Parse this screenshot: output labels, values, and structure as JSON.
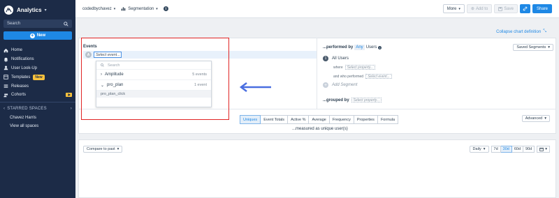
{
  "app": {
    "title": "Analytics"
  },
  "sidebar": {
    "search_label": "Search",
    "new_label": "New",
    "items": [
      {
        "label": "Home",
        "icon": "home-icon"
      },
      {
        "label": "Notifications",
        "icon": "bell-icon"
      },
      {
        "label": "User Look-Up",
        "icon": "user-icon"
      },
      {
        "label": "Templates",
        "icon": "templates-icon",
        "badge": "New"
      },
      {
        "label": "Releases",
        "icon": "releases-icon"
      },
      {
        "label": "Cohorts",
        "icon": "cohorts-icon"
      }
    ],
    "starred_label": "STARRED SPACES",
    "spaces": [
      "Chavez Harris",
      "View all spaces"
    ]
  },
  "topbar": {
    "project": "codedbychavez",
    "chart_type": "Segmentation",
    "more_label": "More",
    "add_to_label": "Add to",
    "save_label": "Save",
    "share_label": "Share"
  },
  "main": {
    "collapse_label": "Collapse chart definition",
    "events": {
      "title": "Events",
      "letter": "A",
      "input_value": "Select event...",
      "dropdown": {
        "search_placeholder": "Search",
        "groups": [
          {
            "name": "Amplitude",
            "count": "5 events",
            "expanded": false
          },
          {
            "name": "pro_plan",
            "count": "1 event",
            "expanded": true
          }
        ],
        "event_item": "pro_plan_click"
      }
    },
    "segment": {
      "performed_by": "...performed by",
      "any": "Any",
      "users": "Users",
      "saved_segments": "Saved Segments",
      "row_number": "1",
      "all_users": "All Users",
      "where_label": "where",
      "select_property": "Select property...",
      "who_performed_label": "and who performed",
      "select_event": "Select event...",
      "add_segment": "Add Segment",
      "grouped_by": "...grouped by"
    },
    "tabs": [
      "Uniques",
      "Event Totals",
      "Active %",
      "Average",
      "Frequency",
      "Properties",
      "Formula"
    ],
    "active_tab": "Uniques",
    "measured_text": "...measured as unique user(s)",
    "advanced_label": "Advanced",
    "compare_label": "Compare to past",
    "interval_label": "Daily",
    "ranges": [
      "7d",
      "30d",
      "60d",
      "90d"
    ],
    "active_range": "30d"
  },
  "colors": {
    "sidebar_bg": "#1c2b47",
    "accent": "#1e88e5",
    "highlight": "#e02424",
    "badge": "#f9c23c"
  }
}
